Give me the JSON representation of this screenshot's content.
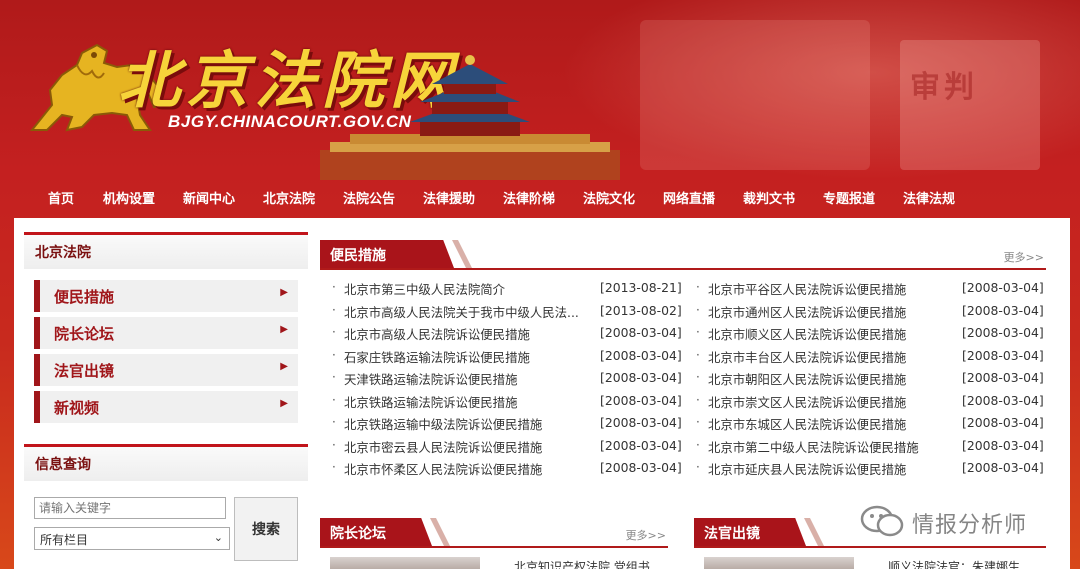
{
  "header": {
    "site_title": "北京法院网",
    "site_url": "BJGY.CHINACOURT.GOV.CN",
    "background_sign_text": "审判"
  },
  "nav": {
    "items": [
      "首页",
      "机构设置",
      "新闻中心",
      "北京法院",
      "法院公告",
      "法律援助",
      "法律阶梯",
      "法院文化",
      "网络直播",
      "裁判文书",
      "专题报道",
      "法律法规"
    ]
  },
  "sidebar": {
    "court_box_title": "北京法院",
    "court_items": [
      {
        "label": "便民措施"
      },
      {
        "label": "院长论坛"
      },
      {
        "label": "法官出镜"
      },
      {
        "label": "新视频"
      }
    ],
    "search_box_title": "信息查询",
    "search_placeholder": "请输入关键字",
    "select_value": "所有栏目",
    "search_button": "搜索"
  },
  "convenience": {
    "title": "便民措施",
    "more": "更多>>",
    "left": [
      {
        "title": "北京市第三中级人民法院简介",
        "date": "[2013-08-21]"
      },
      {
        "title": "北京市高级人民法院关于我市中级人民法...",
        "date": "[2013-08-02]"
      },
      {
        "title": "北京市高级人民法院诉讼便民措施",
        "date": "[2008-03-04]"
      },
      {
        "title": "石家庄铁路运输法院诉讼便民措施",
        "date": "[2008-03-04]"
      },
      {
        "title": "天津铁路运输法院诉讼便民措施",
        "date": "[2008-03-04]"
      },
      {
        "title": "北京铁路运输法院诉讼便民措施",
        "date": "[2008-03-04]"
      },
      {
        "title": "北京铁路运输中级法院诉讼便民措施",
        "date": "[2008-03-04]"
      },
      {
        "title": "北京市密云县人民法院诉讼便民措施",
        "date": "[2008-03-04]"
      },
      {
        "title": "北京市怀柔区人民法院诉讼便民措施",
        "date": "[2008-03-04]"
      }
    ],
    "right": [
      {
        "title": "北京市平谷区人民法院诉讼便民措施",
        "date": "[2008-03-04]"
      },
      {
        "title": "北京市通州区人民法院诉讼便民措施",
        "date": "[2008-03-04]"
      },
      {
        "title": "北京市顺义区人民法院诉讼便民措施",
        "date": "[2008-03-04]"
      },
      {
        "title": "北京市丰台区人民法院诉讼便民措施",
        "date": "[2008-03-04]"
      },
      {
        "title": "北京市朝阳区人民法院诉讼便民措施",
        "date": "[2008-03-04]"
      },
      {
        "title": "北京市崇文区人民法院诉讼便民措施",
        "date": "[2008-03-04]"
      },
      {
        "title": "北京市东城区人民法院诉讼便民措施",
        "date": "[2008-03-04]"
      },
      {
        "title": "北京市第二中级人民法院诉讼便民措施",
        "date": "[2008-03-04]"
      },
      {
        "title": "北京市延庆县人民法院诉讼便民措施",
        "date": "[2008-03-04]"
      }
    ]
  },
  "president_forum": {
    "title": "院长论坛",
    "more": "更多>>",
    "caption": "北京知识产权法院 党组书"
  },
  "judges_on_camera": {
    "title": "法官出镜",
    "caption": "顺义法院法官：朱建娜生"
  },
  "watermark": {
    "text": "情报分析师"
  },
  "colors": {
    "brand_red": "#a9141a",
    "title_gold": "#f7d43a"
  },
  "icons": [
    "lion-emblem-icon",
    "temple-of-heaven-icon",
    "chevron-right-icon",
    "chevron-down-icon",
    "bullet-icon",
    "wechat-icon"
  ]
}
